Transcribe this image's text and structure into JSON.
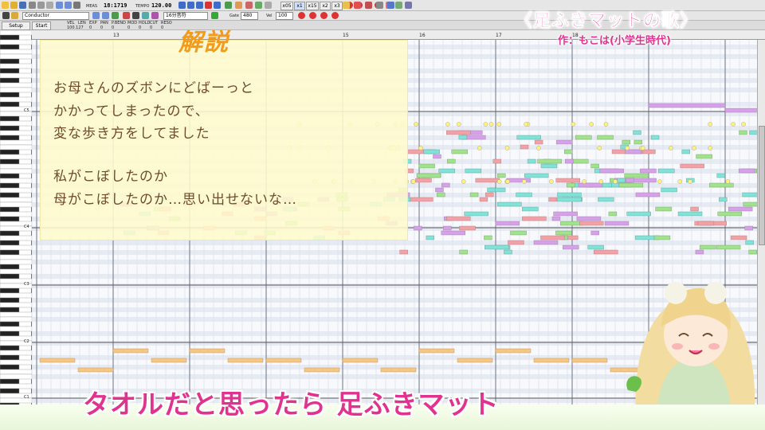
{
  "toolbar": {
    "position_label": "MEAS",
    "position": "18:1719",
    "tempo_label": "TEMPO",
    "tempo": "120.00",
    "track_select": "Conductor",
    "note_length": "16分音符",
    "gate_label": "Gate",
    "gate_value": "480",
    "vel_label": "Vel",
    "vel_value": "100",
    "zoom_buttons": [
      "x05",
      "x1",
      "x15",
      "x2",
      "x3"
    ],
    "setup_tab": "Setup",
    "start_tab": "Start",
    "param_labels": [
      "VEL",
      "LEN",
      "EXP",
      "PAN",
      "P.BEND",
      "MOD",
      "HOLD",
      "CUT",
      "RESO"
    ],
    "param_values": [
      "100.127",
      "0",
      "0",
      "0",
      "0",
      "0",
      "0",
      "0",
      "0"
    ]
  },
  "ruler": {
    "marks": [
      "13",
      "15",
      "16",
      "17",
      "18"
    ]
  },
  "piano": {
    "octave_labels": [
      "C5",
      "C4",
      "C3",
      "C2",
      "C1"
    ]
  },
  "overlay": {
    "heading": "解説",
    "lines": [
      "お母さんのズボンにどばーっと",
      "かかってしまったので、",
      "変な歩き方をしてました",
      "",
      "私がこぼしたのか",
      "母がこぼしたのか…思い出せないな…"
    ]
  },
  "song_title": "〈足ふきマットの歌〉",
  "author": "作：もこは(小学生時代)",
  "subtitle": "タオルだと思ったら 足ふきマット",
  "colors": {
    "accent_pink": "#e0338f",
    "heading_orange": "#f39b1a",
    "note_cyan": "#7ee3d9",
    "note_green": "#9fe38a",
    "note_pink": "#f3a0a6",
    "note_purple": "#d7a0ea",
    "note_yellow": "#fff27a",
    "bass_orange": "#f5c882"
  }
}
